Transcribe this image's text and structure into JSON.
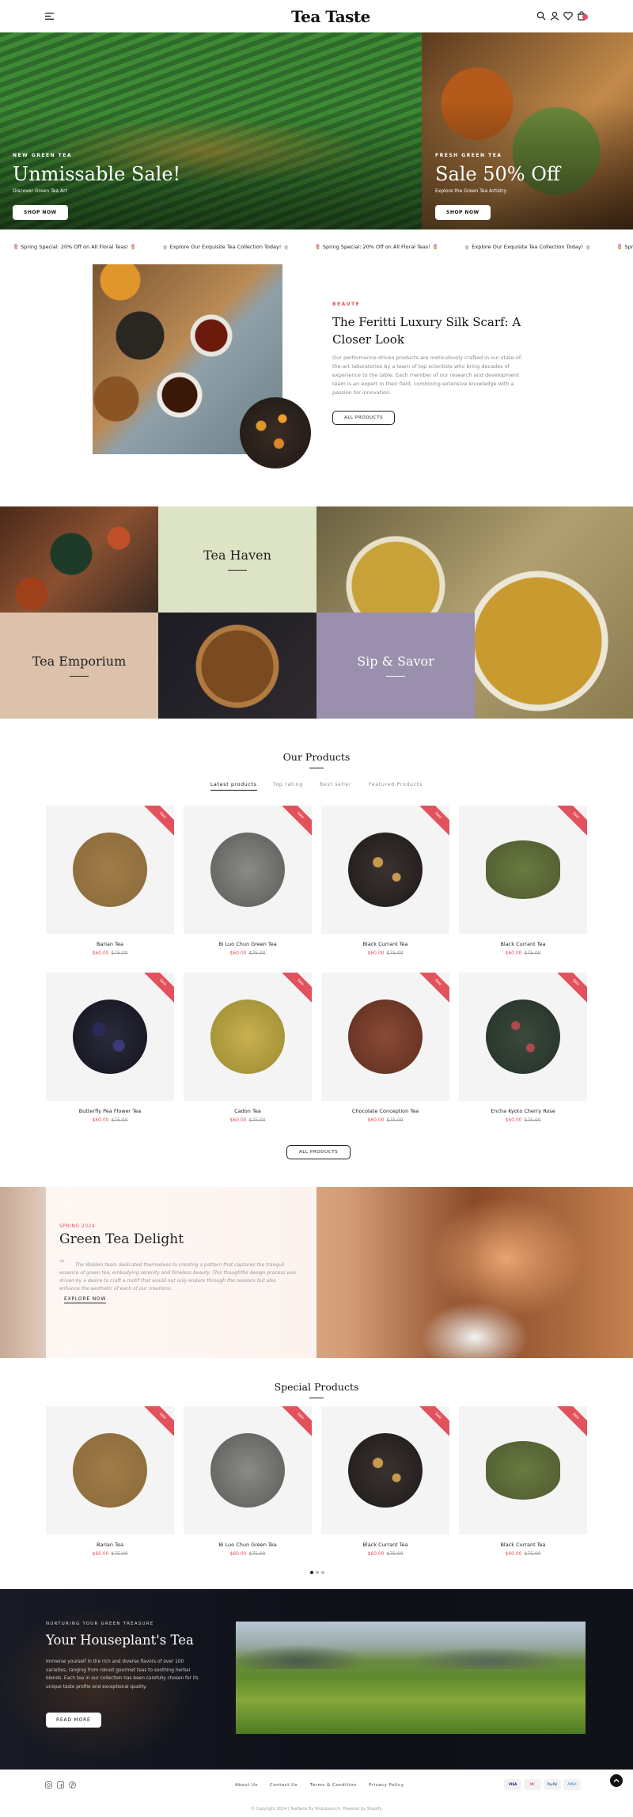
{
  "header": {
    "logo": "Tea Taste"
  },
  "hero": [
    {
      "eyebrow": "NEW GREEN TEA",
      "title": "Unmissable Sale!",
      "subtitle": "Discover Green Tea Art",
      "button": "SHOP NOW"
    },
    {
      "eyebrow": "FRESH GREEN TEA",
      "title": "Sale 50% Off",
      "subtitle": "Explore the Green Tea Artistry",
      "button": "SHOP NOW"
    }
  ],
  "marquee": {
    "items": [
      "🌷 Spring Special: 20% Off on All Floral Teas! 🌷",
      "🍵 Explore Our Exquisite Tea Collection Today! 🍵",
      "🌷 Spring Special: 20% Off on All Floral Teas! 🌷",
      "🍵 Explore Our Exquisite Tea Collection Today! 🍵",
      "🌷 Spring Speci"
    ]
  },
  "about": {
    "tag": "BEAUTE",
    "title": "The Feritti Luxury Silk Scarf: A Closer Look",
    "body": "Our performance-driven products are meticulously crafted in our state-of-the-art laboratories by a team of top scientists who bring decades of experience to the table. Each member of our research and development team is an expert in their field, combining extensive knowledge with a passion for innovation.",
    "button": "ALL PRODUCTS"
  },
  "collage": {
    "tea_haven": "Tea Haven",
    "tea_emporium": "Tea Emporium",
    "sip_savor": "Sip & Savor"
  },
  "products_section": {
    "title": "Our Products",
    "tabs": [
      "Latest products",
      "Top rating",
      "Best seller",
      "Featured Products"
    ],
    "badge": "Sale",
    "button": "ALL PRODUCTS",
    "items": [
      {
        "name": "Barian Tea",
        "price": "$60.00",
        "old_price": "$75.00"
      },
      {
        "name": "Bi Luo Chun Green Tea",
        "price": "$60.00",
        "old_price": "$75.00"
      },
      {
        "name": "Black Currant Tea",
        "price": "$60.00",
        "old_price": "$75.00"
      },
      {
        "name": "Black Currant Tea",
        "price": "$60.00",
        "old_price": "$75.00"
      },
      {
        "name": "Butterfly Pea Flower Tea",
        "price": "$60.00",
        "old_price": "$75.00"
      },
      {
        "name": "Cadon Tea",
        "price": "$60.00",
        "old_price": "$75.00"
      },
      {
        "name": "Chocolate Conception Tea",
        "price": "$60.00",
        "old_price": "$75.00"
      },
      {
        "name": "Encha Kyoto Cherry Rose",
        "price": "$60.00",
        "old_price": "$75.00"
      }
    ]
  },
  "green_tea": {
    "tag": "SPRING 2024",
    "title": "Green Tea Delight",
    "quote": "The Walden team dedicated themselves to creating a pattern that captures the tranquil essence of green tea, embodying serenity and timeless beauty. This thoughtful design process was driven by a desire to craft a motif that would not only endure through the seasons but also enhance the aesthetic of each of our creations.",
    "link": "EXPLORE NOW"
  },
  "special_section": {
    "title": "Special Products",
    "badge": "Sale",
    "items": [
      {
        "name": "Barian Tea",
        "price": "$60.00",
        "old_price": "$75.00"
      },
      {
        "name": "Bi Luo Chun Green Tea",
        "price": "$60.00",
        "old_price": "$75.00"
      },
      {
        "name": "Black Currant Tea",
        "price": "$60.00",
        "old_price": "$75.00"
      },
      {
        "name": "Black Currant Tea",
        "price": "$60.00",
        "old_price": "$75.00"
      }
    ]
  },
  "houseplant": {
    "eyebrow": "NURTURING YOUR GREEN TREASURE",
    "title": "Your Houseplant's Tea",
    "body": "Immerse yourself in the rich and diverse flavors of over 100 varieties, ranging from robust gourmet teas to soothing herbal blends. Each tea in our collection has been carefully chosen for its unique taste profile and exceptional quality.",
    "button": "READ MORE"
  },
  "footer": {
    "links": [
      "About Us",
      "Contact Us",
      "Terms & Condition",
      "Privacy Policy"
    ],
    "payments": [
      "VISA",
      "MC",
      "PayPal",
      "AMEX"
    ],
    "copyright": "© Copyright 2024 | TeaTaste By ShopiLaunch. Powered by Shopify."
  },
  "colors": {
    "accent": "#e2525c",
    "tea_haven_bg": "#dde4c6",
    "tea_emporium_bg": "#dcc2aa",
    "sip_savor_bg": "#9a8fad"
  }
}
